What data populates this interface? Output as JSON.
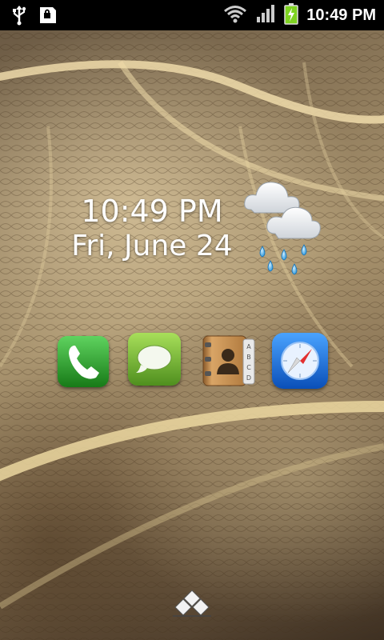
{
  "status_bar": {
    "time": "10:49 PM",
    "icons": [
      "usb-icon",
      "sd-card-icon",
      "wifi-icon",
      "signal-icon",
      "battery-charging-icon"
    ]
  },
  "clock_widget": {
    "time": "10:49 PM",
    "date": "Fri, June 24",
    "weather_icon": "rain-cloud-icon"
  },
  "dock": {
    "apps": [
      {
        "name": "phone",
        "icon": "phone-icon",
        "color": "#2a9a2a"
      },
      {
        "name": "messages",
        "icon": "speech-bubble-icon",
        "color": "#6fae2e"
      },
      {
        "name": "contacts",
        "icon": "contacts-book-icon",
        "color": "#c08a4a"
      },
      {
        "name": "browser",
        "icon": "compass-icon",
        "color": "#1d6fd6"
      }
    ]
  },
  "app_drawer": {
    "icon": "app-drawer-icon"
  }
}
